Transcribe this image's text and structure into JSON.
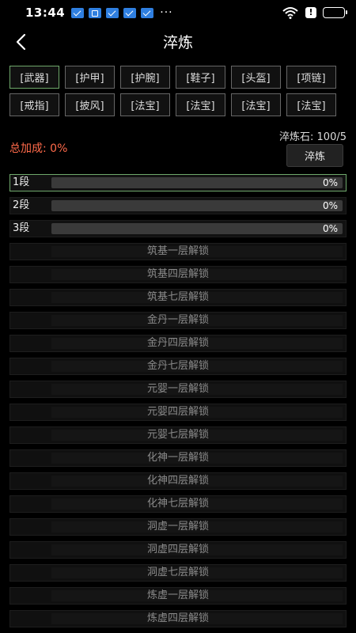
{
  "status_bar": {
    "time": "13:44",
    "dots": "···"
  },
  "header": {
    "title": "淬炼"
  },
  "equipment_tabs": [
    {
      "label": "[武器]",
      "active": true
    },
    {
      "label": "[护甲]",
      "active": false
    },
    {
      "label": "[护腕]",
      "active": false
    },
    {
      "label": "[鞋子]",
      "active": false
    },
    {
      "label": "[头盔]",
      "active": false
    },
    {
      "label": "[项链]",
      "active": false
    },
    {
      "label": "[戒指]",
      "active": false
    },
    {
      "label": "[披风]",
      "active": false
    },
    {
      "label": "[法宝]",
      "active": false
    },
    {
      "label": "[法宝]",
      "active": false
    },
    {
      "label": "[法宝]",
      "active": false
    },
    {
      "label": "[法宝]",
      "active": false
    }
  ],
  "temper": {
    "stone_text": "淬炼石: 100/5",
    "total_bonus": "总加成: 0%",
    "button_label": "淬炼"
  },
  "stages": [
    {
      "label": "1段",
      "percent": "0%",
      "progress": 0,
      "selected": true
    },
    {
      "label": "2段",
      "percent": "0%",
      "progress": 0,
      "selected": false
    },
    {
      "label": "3段",
      "percent": "0%",
      "progress": 0,
      "selected": false
    }
  ],
  "locked_stages": [
    {
      "text": "筑基一层解锁"
    },
    {
      "text": "筑基四层解锁"
    },
    {
      "text": "筑基七层解锁"
    },
    {
      "text": "金丹一层解锁"
    },
    {
      "text": "金丹四层解锁"
    },
    {
      "text": "金丹七层解锁"
    },
    {
      "text": "元婴一层解锁"
    },
    {
      "text": "元婴四层解锁"
    },
    {
      "text": "元婴七层解锁"
    },
    {
      "text": "化神一层解锁"
    },
    {
      "text": "化神四层解锁"
    },
    {
      "text": "化神七层解锁"
    },
    {
      "text": "洞虚一层解锁"
    },
    {
      "text": "洞虚四层解锁"
    },
    {
      "text": "洞虚七层解锁"
    },
    {
      "text": "炼虚一层解锁"
    },
    {
      "text": "炼虚四层解锁"
    }
  ],
  "colors": {
    "accent": "#6fa86b",
    "bonus": "#ff6a4a"
  },
  "icons": {
    "back": "chevron-left-icon",
    "wifi": "wifi-icon",
    "battery": "battery-icon",
    "alert": "alert-icon"
  }
}
